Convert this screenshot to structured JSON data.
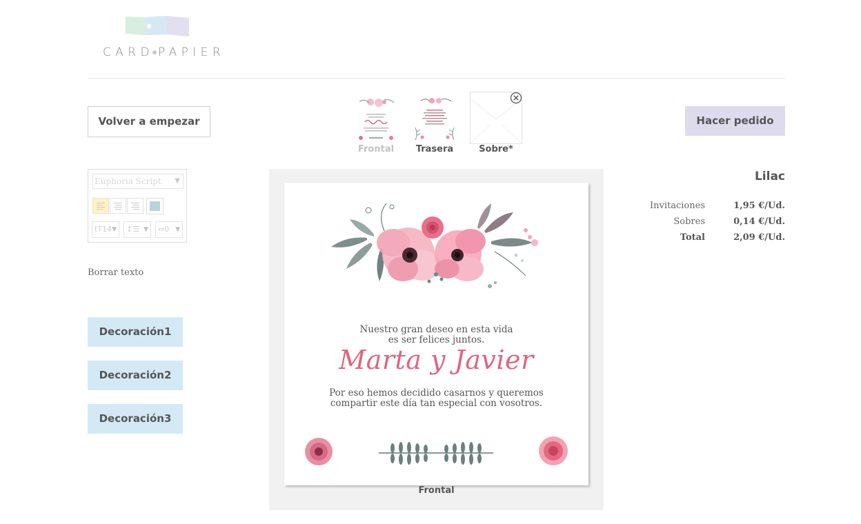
{
  "brand": {
    "logo_text_left": "CARD",
    "logo_text_right": "PAPIER"
  },
  "toolbar": {
    "restart_label": "Volver a empezar",
    "order_label": "Hacer pedido"
  },
  "views": {
    "front_label": "Frontal",
    "back_label": "Trasera",
    "envelope_label": "Sobre*"
  },
  "editor": {
    "font_name": "Euphoria Script",
    "font_size": "14",
    "line_height": "☰",
    "letter_spacing": "0",
    "clear_text_label": "Borrar texto",
    "text_color": "#b9d3dc"
  },
  "decorations": [
    "Decoración1",
    "Decoración2",
    "Decoración3"
  ],
  "card": {
    "line1": "Nuestro gran deseo en esta vida",
    "line2": "es ser felices juntos.",
    "names": "Marta y Javier",
    "line3": "Por eso hemos decidido casarnos y queremos",
    "line4": "compartir este día tan especial con vosotros.",
    "current_side": "Frontal"
  },
  "pricing": {
    "product_name": "Lilac",
    "rows": [
      {
        "label": "Invitaciones",
        "value": "1,95 €/Ud."
      },
      {
        "label": "Sobres",
        "value": "0,14 €/Ud."
      },
      {
        "label": "Total",
        "value": "2,09 €/Ud."
      }
    ]
  },
  "colors": {
    "order_button": "#dedbec",
    "decoration_button": "#d4e9f6",
    "names_pink": "#e0647f",
    "canvas_bg": "#f1f1f1"
  }
}
